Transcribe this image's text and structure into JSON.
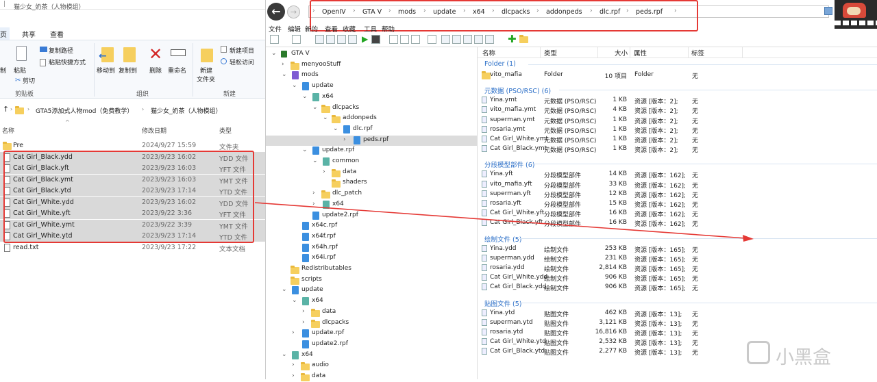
{
  "explorer": {
    "title": "猫少女_奶茶（人物模组）",
    "tabs": [
      "页",
      "共享",
      "查看"
    ],
    "ribbon": {
      "copy_path": "复制路径",
      "paste": "粘贴",
      "paste_shortcut": "粘贴快捷方式",
      "cut": "剪切",
      "clipboard": "剪贴板",
      "move_to": "移动到",
      "copy_to": "复制到",
      "delete": "删除",
      "rename": "重命名",
      "organize": "组织",
      "new_folder_1": "新建",
      "new_folder_2": "文件夹",
      "new_item": "新建项目",
      "easy_access": "轻松访问",
      "new": "新建",
      "left_cut1": "制",
      "left_cut2": "剪"
    },
    "breadcrumb": [
      "GTA5添加式人物mod（免费教学）",
      "猫少女_奶茶（人物模组）"
    ],
    "columns": {
      "name": "名称",
      "date": "修改日期",
      "type": "类型"
    },
    "files": [
      {
        "name": "Pre",
        "date": "2024/9/27 15:59",
        "type": "文件夹",
        "kind": "folder",
        "selected": false
      },
      {
        "name": "Cat Girl_Black.ydd",
        "date": "2023/9/23 16:02",
        "type": "YDD 文件",
        "kind": "file",
        "selected": true
      },
      {
        "name": "Cat Girl_Black.yft",
        "date": "2023/9/23 16:03",
        "type": "YFT 文件",
        "kind": "file",
        "selected": true
      },
      {
        "name": "Cat Girl_Black.ymt",
        "date": "2023/9/23 16:03",
        "type": "YMT 文件",
        "kind": "file",
        "selected": true
      },
      {
        "name": "Cat Girl_Black.ytd",
        "date": "2023/9/23 17:14",
        "type": "YTD 文件",
        "kind": "file",
        "selected": true
      },
      {
        "name": "Cat Girl_White.ydd",
        "date": "2023/9/23 16:02",
        "type": "YDD 文件",
        "kind": "file",
        "selected": true
      },
      {
        "name": "Cat Girl_White.yft",
        "date": "2023/9/22 3:36",
        "type": "YFT 文件",
        "kind": "file",
        "selected": true
      },
      {
        "name": "Cat Girl_White.ymt",
        "date": "2023/9/22 3:39",
        "type": "YMT 文件",
        "kind": "file",
        "selected": true
      },
      {
        "name": "Cat Girl_White.ytd",
        "date": "2023/9/23 17:14",
        "type": "YTD 文件",
        "kind": "file",
        "selected": true
      },
      {
        "name": "read.txt",
        "date": "2023/9/23 17:22",
        "type": "文本文档",
        "kind": "file",
        "selected": false
      }
    ]
  },
  "openiv": {
    "path": [
      "OpenIV",
      "GTA V",
      "mods",
      "update",
      "x64",
      "dlcpacks",
      "addonpeds",
      "dlc.rpf",
      "peds.rpf"
    ],
    "menu": [
      "文件",
      "编辑",
      "新的",
      "查看",
      "收藏",
      "工具",
      "帮助"
    ],
    "tree": [
      {
        "label": "GTA V",
        "depth": 0,
        "icon": "gta",
        "chev": "v"
      },
      {
        "label": "menyooStuff",
        "depth": 1,
        "icon": "folder",
        "chev": ">"
      },
      {
        "label": "mods",
        "depth": 1,
        "icon": "purple",
        "chev": "v"
      },
      {
        "label": "update",
        "depth": 2,
        "icon": "rpf",
        "chev": "v"
      },
      {
        "label": "x64",
        "depth": 3,
        "icon": "teal",
        "chev": "v"
      },
      {
        "label": "dlcpacks",
        "depth": 4,
        "icon": "folder",
        "chev": "v"
      },
      {
        "label": "addonpeds",
        "depth": 5,
        "icon": "folder",
        "chev": "v"
      },
      {
        "label": "dlc.rpf",
        "depth": 6,
        "icon": "rpf",
        "chev": "v"
      },
      {
        "label": "peds.rpf",
        "depth": 7,
        "icon": "rpf",
        "chev": ">",
        "selected": true
      },
      {
        "label": "update.rpf",
        "depth": 3,
        "icon": "rpf",
        "chev": "v"
      },
      {
        "label": "common",
        "depth": 4,
        "icon": "teal",
        "chev": "v"
      },
      {
        "label": "data",
        "depth": 5,
        "icon": "folder",
        "chev": ">"
      },
      {
        "label": "shaders",
        "depth": 5,
        "icon": "folder",
        "chev": ""
      },
      {
        "label": "dlc_patch",
        "depth": 4,
        "icon": "folder",
        "chev": ">"
      },
      {
        "label": "x64",
        "depth": 4,
        "icon": "teal",
        "chev": ">"
      },
      {
        "label": "update2.rpf",
        "depth": 3,
        "icon": "rpf",
        "chev": ""
      },
      {
        "label": "x64c.rpf",
        "depth": 2,
        "icon": "rpf",
        "chev": ""
      },
      {
        "label": "x64f.rpf",
        "depth": 2,
        "icon": "rpf",
        "chev": ""
      },
      {
        "label": "x64h.rpf",
        "depth": 2,
        "icon": "rpf",
        "chev": ""
      },
      {
        "label": "x64i.rpf",
        "depth": 2,
        "icon": "rpf",
        "chev": ""
      },
      {
        "label": "Redistributables",
        "depth": 1,
        "icon": "folder",
        "chev": ""
      },
      {
        "label": "scripts",
        "depth": 1,
        "icon": "folder",
        "chev": ""
      },
      {
        "label": "update",
        "depth": 1,
        "icon": "rpf",
        "chev": "v"
      },
      {
        "label": "x64",
        "depth": 2,
        "icon": "teal",
        "chev": "v"
      },
      {
        "label": "data",
        "depth": 3,
        "icon": "folder",
        "chev": ">"
      },
      {
        "label": "dlcpacks",
        "depth": 3,
        "icon": "folder",
        "chev": ">"
      },
      {
        "label": "update.rpf",
        "depth": 2,
        "icon": "rpf",
        "chev": ">"
      },
      {
        "label": "update2.rpf",
        "depth": 2,
        "icon": "rpf",
        "chev": ""
      },
      {
        "label": "x64",
        "depth": 1,
        "icon": "teal",
        "chev": "v"
      },
      {
        "label": "audio",
        "depth": 2,
        "icon": "folder",
        "chev": ">"
      },
      {
        "label": "data",
        "depth": 2,
        "icon": "folder",
        "chev": ">"
      }
    ],
    "columns": {
      "name": "名称",
      "type": "类型",
      "size": "大小",
      "attr": "属性",
      "tag": "标签"
    },
    "sections": [
      {
        "title": "Folder (1)",
        "rows": [
          {
            "name": "vito_mafia",
            "type": "Folder",
            "size": "10 项目",
            "attr": "Folder",
            "tag": "无",
            "folder": true
          }
        ]
      },
      {
        "title": "元数据 (PSO/RSC) (6)",
        "rows": [
          {
            "name": "Yina.ymt",
            "type": "元数据 (PSO/RSC)",
            "size": "1 KB",
            "attr": "资源 [版本：2];",
            "tag": "无"
          },
          {
            "name": "vito_mafia.ymt",
            "type": "元数据 (PSO/RSC)",
            "size": "4 KB",
            "attr": "资源 [版本：2];",
            "tag": "无"
          },
          {
            "name": "superman.ymt",
            "type": "元数据 (PSO/RSC)",
            "size": "1 KB",
            "attr": "资源 [版本：2];",
            "tag": "无"
          },
          {
            "name": "rosaria.ymt",
            "type": "元数据 (PSO/RSC)",
            "size": "1 KB",
            "attr": "资源 [版本：2];",
            "tag": "无"
          },
          {
            "name": "Cat Girl_White.ymt",
            "type": "元数据 (PSO/RSC)",
            "size": "1 KB",
            "attr": "资源 [版本：2];",
            "tag": "无"
          },
          {
            "name": "Cat Girl_Black.ymt",
            "type": "元数据 (PSO/RSC)",
            "size": "1 KB",
            "attr": "资源 [版本：2];",
            "tag": "无"
          }
        ]
      },
      {
        "title": "分段模型部件 (6)",
        "rows": [
          {
            "name": "Yina.yft",
            "type": "分段模型部件",
            "size": "14 KB",
            "attr": "资源 [版本：162];",
            "tag": "无"
          },
          {
            "name": "vito_mafia.yft",
            "type": "分段模型部件",
            "size": "33 KB",
            "attr": "资源 [版本：162];",
            "tag": "无"
          },
          {
            "name": "superman.yft",
            "type": "分段模型部件",
            "size": "12 KB",
            "attr": "资源 [版本：162];",
            "tag": "无"
          },
          {
            "name": "rosaria.yft",
            "type": "分段模型部件",
            "size": "15 KB",
            "attr": "资源 [版本：162];",
            "tag": "无"
          },
          {
            "name": "Cat Girl_White.yft",
            "type": "分段模型部件",
            "size": "16 KB",
            "attr": "资源 [版本：162];",
            "tag": "无"
          },
          {
            "name": "Cat Girl_Black.yft",
            "type": "分段模型部件",
            "size": "16 KB",
            "attr": "资源 [版本：162];",
            "tag": "无"
          }
        ]
      },
      {
        "title": "绘制文件 (5)",
        "rows": [
          {
            "name": "Yina.ydd",
            "type": "绘制文件",
            "size": "253 KB",
            "attr": "资源 [版本：165];",
            "tag": "无"
          },
          {
            "name": "superman.ydd",
            "type": "绘制文件",
            "size": "231 KB",
            "attr": "资源 [版本：165];",
            "tag": "无"
          },
          {
            "name": "rosaria.ydd",
            "type": "绘制文件",
            "size": "2,814 KB",
            "attr": "资源 [版本：165];",
            "tag": "无"
          },
          {
            "name": "Cat Girl_White.ydd",
            "type": "绘制文件",
            "size": "906 KB",
            "attr": "资源 [版本：165];",
            "tag": "无"
          },
          {
            "name": "Cat Girl_Black.ydd",
            "type": "绘制文件",
            "size": "906 KB",
            "attr": "资源 [版本：165];",
            "tag": "无"
          }
        ]
      },
      {
        "title": "贴图文件 (5)",
        "rows": [
          {
            "name": "Yina.ytd",
            "type": "贴图文件",
            "size": "462 KB",
            "attr": "资源 [版本：13];",
            "tag": "无"
          },
          {
            "name": "superman.ytd",
            "type": "贴图文件",
            "size": "3,121 KB",
            "attr": "资源 [版本：13];",
            "tag": "无"
          },
          {
            "name": "rosaria.ytd",
            "type": "贴图文件",
            "size": "16,816 KB",
            "attr": "资源 [版本：13];",
            "tag": "无"
          },
          {
            "name": "Cat Girl_White.ytd",
            "type": "贴图文件",
            "size": "2,532 KB",
            "attr": "资源 [版本：13];",
            "tag": "无"
          },
          {
            "name": "Cat Girl_Black.ytd",
            "type": "贴图文件",
            "size": "2,277 KB",
            "attr": "资源 [版本：13];",
            "tag": "无"
          }
        ]
      }
    ]
  },
  "watermark": "小黑盒",
  "colors": {
    "highlight": "#e53935",
    "selected_row": "#d9d9d9",
    "tree_selected": "#dcdcdc",
    "section": "#2a6ec7"
  }
}
